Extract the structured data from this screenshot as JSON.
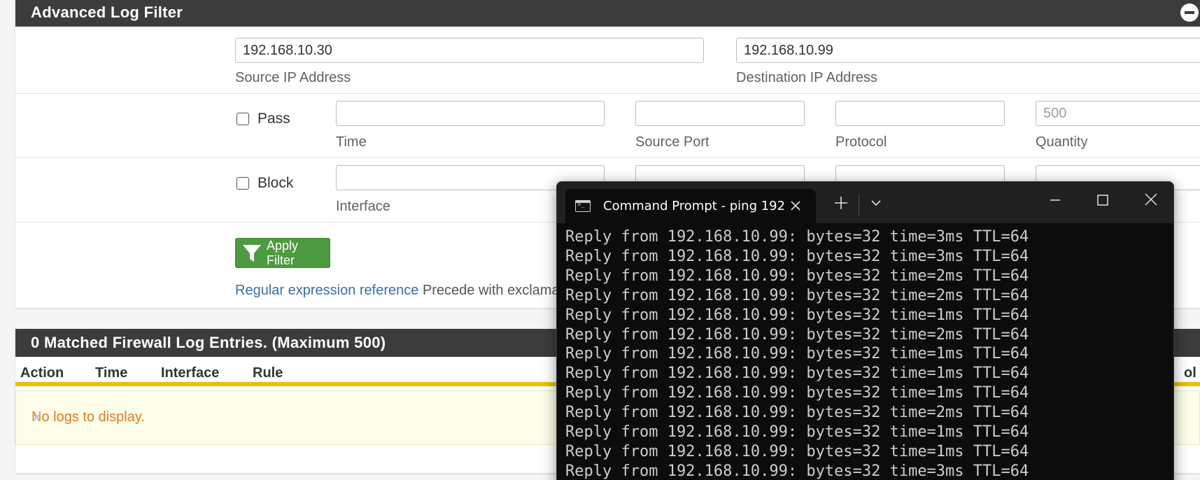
{
  "filter_panel": {
    "title": "Advanced Log Filter",
    "source_ip": {
      "value": "192.168.10.30",
      "label": "Source IP Address"
    },
    "destination_ip": {
      "value": "192.168.10.99",
      "label": "Destination IP Address"
    },
    "pass": {
      "label": "Pass",
      "checked": false
    },
    "block": {
      "label": "Block",
      "checked": false
    },
    "time": {
      "value": "",
      "label": "Time"
    },
    "source_port": {
      "value": "",
      "label": "Source Port"
    },
    "protocol": {
      "value": "",
      "label": "Protocol"
    },
    "quantity": {
      "value": "",
      "placeholder": "500",
      "label": "Quantity"
    },
    "interface": {
      "value": "",
      "label": "Interface"
    },
    "apply_button": "Apply Filter",
    "regex_link": "Regular expression reference",
    "regex_text": "Precede with exclama"
  },
  "log_panel": {
    "title": "0 Matched Firewall Log Entries. (Maximum 500)",
    "columns": [
      "Action",
      "Time",
      "Interface",
      "Rule"
    ],
    "partial_column": "ol",
    "empty_message": "No logs to display.",
    "dismiss": "×"
  },
  "terminal": {
    "tab_title": "Command Prompt - ping  192",
    "lines": [
      "Reply from 192.168.10.99: bytes=32 time=3ms TTL=64",
      "Reply from 192.168.10.99: bytes=32 time=3ms TTL=64",
      "Reply from 192.168.10.99: bytes=32 time=2ms TTL=64",
      "Reply from 192.168.10.99: bytes=32 time=2ms TTL=64",
      "Reply from 192.168.10.99: bytes=32 time=1ms TTL=64",
      "Reply from 192.168.10.99: bytes=32 time=2ms TTL=64",
      "Reply from 192.168.10.99: bytes=32 time=1ms TTL=64",
      "Reply from 192.168.10.99: bytes=32 time=1ms TTL=64",
      "Reply from 192.168.10.99: bytes=32 time=1ms TTL=64",
      "Reply from 192.168.10.99: bytes=32 time=2ms TTL=64",
      "Reply from 192.168.10.99: bytes=32 time=1ms TTL=64",
      "Reply from 192.168.10.99: bytes=32 time=1ms TTL=64",
      "Reply from 192.168.10.99: bytes=32 time=3ms TTL=64"
    ]
  },
  "colors": {
    "heading_bg": "#3c3c3c",
    "apply_green": "#4e9a40",
    "link_blue": "#3b6ea5",
    "warning_orange": "#e07b22",
    "warning_bg": "#fdfde9",
    "table_rule_yellow": "#e5c300",
    "terminal_bg": "#0c0c0c"
  }
}
